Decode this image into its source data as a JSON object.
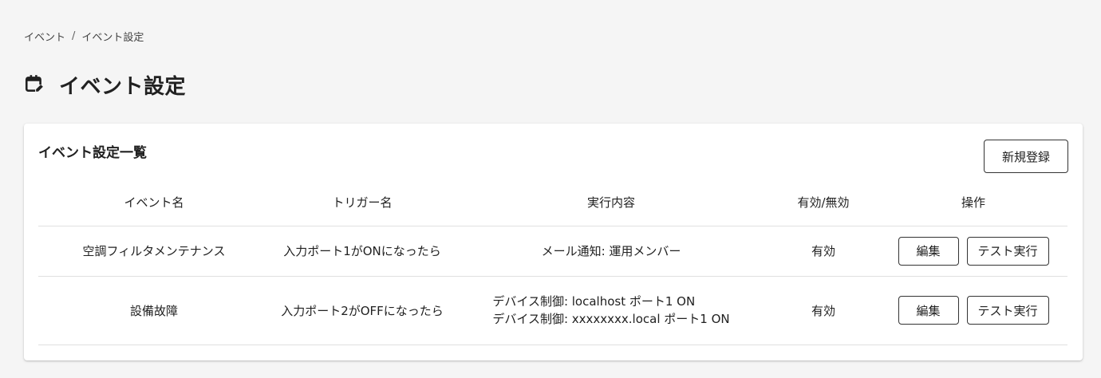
{
  "breadcrumb": {
    "parent": "イベント",
    "separator": "/",
    "current": "イベント設定"
  },
  "page": {
    "title": "イベント設定",
    "icon": "calendar-edit-icon"
  },
  "card": {
    "title": "イベント設定一覧",
    "new_button_label": "新規登録",
    "columns": [
      "イベント名",
      "トリガー名",
      "実行内容",
      "有効/無効",
      "操作"
    ],
    "rows": [
      {
        "event_name": "空調フィルタメンテナンス",
        "trigger_name": "入力ポート1がONになったら",
        "actions": [
          "メール通知:  運用メンバー"
        ],
        "status": "有効",
        "edit_label": "編集",
        "test_label": "テスト実行"
      },
      {
        "event_name": "設備故障",
        "trigger_name": "入力ポート2がOFFになったら",
        "actions": [
          "デバイス制御:  localhost ポート1 ON",
          "デバイス制御:  xxxxxxxx.local ポート1 ON"
        ],
        "status": "有効",
        "edit_label": "編集",
        "test_label": "テスト実行"
      }
    ]
  },
  "colors": {
    "background": "#f5f5f5",
    "card": "#ffffff",
    "border": "#333333",
    "divider": "#e0e0e0"
  }
}
